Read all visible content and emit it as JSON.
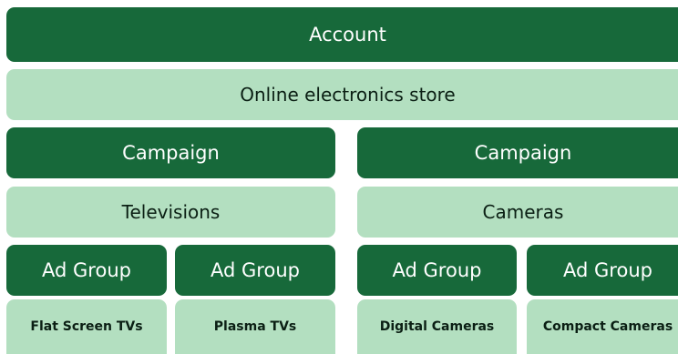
{
  "account": {
    "label": "Account",
    "name": "Online electronics store"
  },
  "campaigns": [
    {
      "label": "Campaign",
      "name": "Televisions",
      "ad_groups": [
        {
          "label": "Ad Group",
          "name": "Flat Screen TVs"
        },
        {
          "label": "Ad Group",
          "name": "Plasma TVs"
        }
      ]
    },
    {
      "label": "Campaign",
      "name": "Cameras",
      "ad_groups": [
        {
          "label": "Ad Group",
          "name": "Digital Cameras"
        },
        {
          "label": "Ad Group",
          "name": "Compact Cameras"
        }
      ]
    }
  ],
  "colors": {
    "dark": "#17693a",
    "light": "#b3dfc0",
    "dark_text": "#ffffff",
    "light_text": "#0b1f14"
  }
}
